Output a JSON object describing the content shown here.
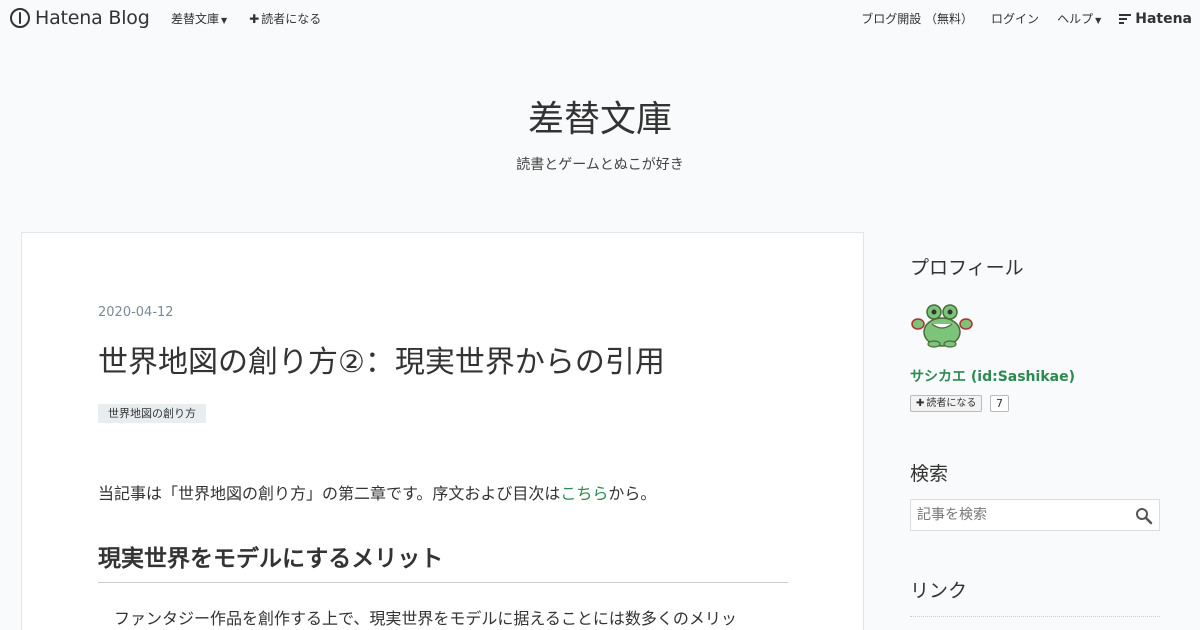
{
  "globalbar": {
    "logo_text": "Hatena Blog",
    "nav_left": [
      {
        "label": "差替文庫",
        "has_caret": true
      },
      {
        "label": "読者になる",
        "has_plus": true
      }
    ],
    "nav_right": [
      {
        "label": "ブログ開設 （無料）"
      },
      {
        "label": "ログイン"
      },
      {
        "label": "ヘルプ",
        "has_caret": true
      }
    ],
    "brand": "Hatena"
  },
  "blog": {
    "title": "差替文庫",
    "description": "読書とゲームとぬこが好き"
  },
  "entry": {
    "date": "2020-04-12",
    "title": "世界地図の創り方②：現実世界からの引用",
    "category": "世界地図の創り方",
    "intro_before": "当記事は「世界地図の創り方」の第二章です。序文および目次は",
    "intro_link": "こちら",
    "intro_after": "から。",
    "heading": "現実世界をモデルにするメリット",
    "body": "ファンタジー作品を創作する上で、現実世界をモデルに据えることには数多くのメリッ"
  },
  "sidebar": {
    "profile_heading": "プロフィール",
    "profile_name": "サシカエ (id:Sashikae)",
    "subscribe_label": "読者になる",
    "subscribe_count": "7",
    "search_heading": "検索",
    "search_placeholder": "記事を検索",
    "link_heading": "リンク"
  },
  "colors": {
    "accent_green": "#2b8a4f",
    "background": "#f9fafb",
    "category_bg": "#e8edf0",
    "date_gray": "#7a8a96"
  }
}
